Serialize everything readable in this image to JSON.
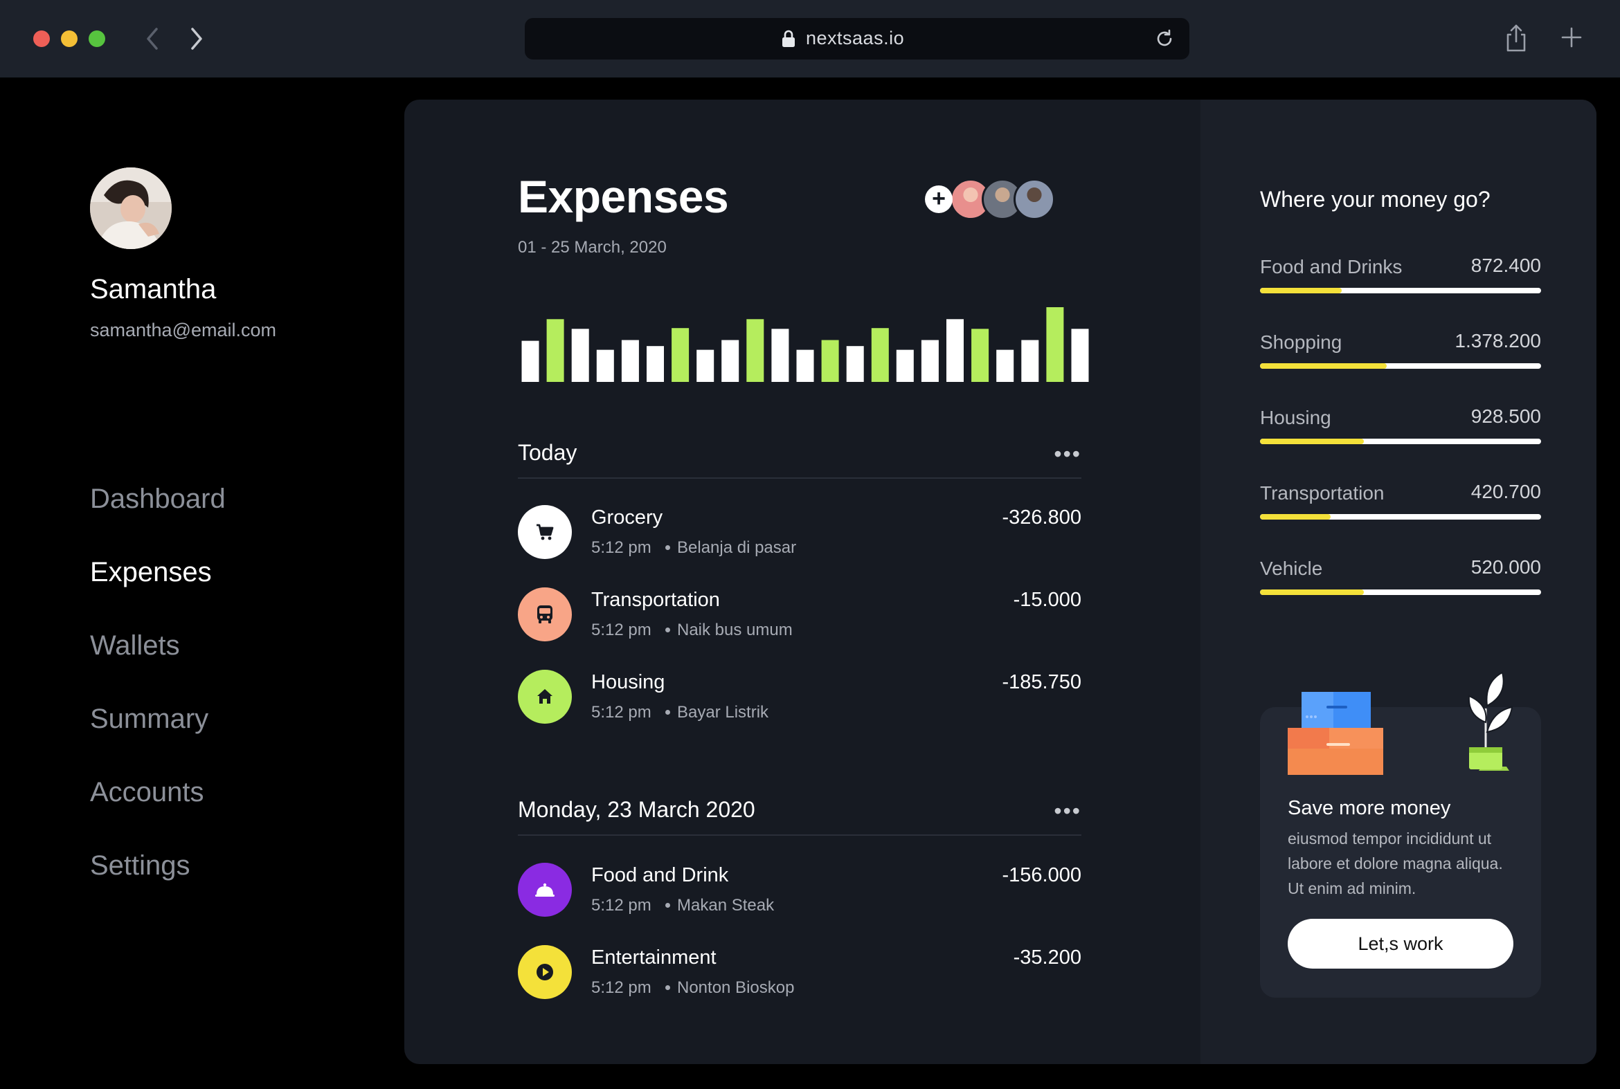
{
  "browser": {
    "url": "nextsaas.io"
  },
  "user": {
    "name": "Samantha",
    "email": "samantha@email.com"
  },
  "nav": [
    {
      "label": "Dashboard",
      "active": false
    },
    {
      "label": "Expenses",
      "active": true
    },
    {
      "label": "Wallets",
      "active": false
    },
    {
      "label": "Summary",
      "active": false
    },
    {
      "label": "Accounts",
      "active": false
    },
    {
      "label": "Settings",
      "active": false
    }
  ],
  "header": {
    "title": "Expenses",
    "date_range": "01 - 25 March, 2020",
    "add_member_label": "+"
  },
  "colors": {
    "accent_green": "#b5ed5d",
    "accent_yellow": "#f4e13a",
    "bar_white": "#ffffff",
    "purple": "#8a2be2",
    "salmon": "#f8a587"
  },
  "chart_data": {
    "type": "bar",
    "values": [
      0.55,
      0.84,
      0.71,
      0.43,
      0.56,
      0.48,
      0.72,
      0.43,
      0.56,
      0.84,
      0.71,
      0.43,
      0.56,
      0.48,
      0.72,
      0.43,
      0.56,
      0.84,
      0.71,
      0.43,
      0.56,
      1.0,
      0.71
    ],
    "highlight": [
      false,
      true,
      false,
      false,
      false,
      false,
      true,
      false,
      false,
      true,
      false,
      false,
      true,
      false,
      true,
      false,
      false,
      false,
      true,
      false,
      false,
      true,
      false
    ]
  },
  "sections": [
    {
      "title": "Today",
      "more_icon": "more-horizontal-icon",
      "transactions": [
        {
          "icon": "cart-icon",
          "name": "Grocery",
          "time": "5:12 pm",
          "note": "Belanja di pasar",
          "amount": "-326.800"
        },
        {
          "icon": "bus-icon",
          "name": "Transportation",
          "time": "5:12 pm",
          "note": "Naik bus umum",
          "amount": "-15.000"
        },
        {
          "icon": "home-icon",
          "name": "Housing",
          "time": "5:12 pm",
          "note": "Bayar Listrik",
          "amount": "-185.750"
        }
      ]
    },
    {
      "title": "Monday, 23 March 2020",
      "more_icon": "more-horizontal-icon",
      "transactions": [
        {
          "icon": "food-cover-icon",
          "name": "Food and Drink",
          "time": "5:12 pm",
          "note": "Makan Steak",
          "amount": "-156.000"
        },
        {
          "icon": "play-icon",
          "name": "Entertainment",
          "time": "5:12 pm",
          "note": "Nonton Bioskop",
          "amount": "-35.200"
        }
      ]
    }
  ],
  "money": {
    "title": "Where your money go?",
    "categories": [
      {
        "label": "Food and Drinks",
        "value": "872.400",
        "progress": 0.29
      },
      {
        "label": "Shopping",
        "value": "1.378.200",
        "progress": 0.45
      },
      {
        "label": "Housing",
        "value": "928.500",
        "progress": 0.37
      },
      {
        "label": "Transportation",
        "value": "420.700",
        "progress": 0.25
      },
      {
        "label": "Vehicle",
        "value": "520.000",
        "progress": 0.37
      }
    ]
  },
  "promo": {
    "title": "Save more money",
    "body": "eiusmod tempor incididunt ut labore et dolore magna aliqua. Ut enim ad minim.",
    "button": "Let,s work"
  }
}
